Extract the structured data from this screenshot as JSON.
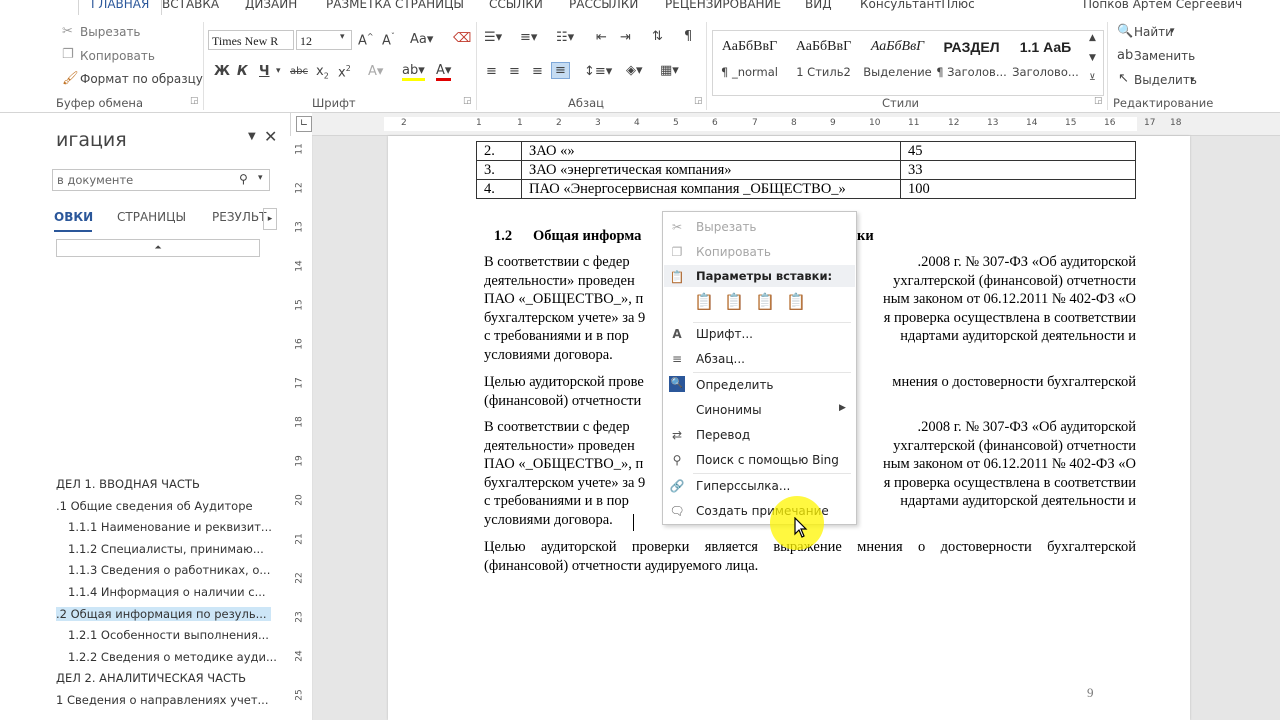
{
  "tabs": [
    "ГЛАВНАЯ",
    "ВСТАВКА",
    "ДИЗАЙН",
    "РАЗМЕТКА СТРАНИЦЫ",
    "ССЫЛКИ",
    "РАССЫЛКИ",
    "РЕЦЕНЗИРОВАНИЕ",
    "ВИД",
    "КонсультантПлюс"
  ],
  "user_name": "Попков Артем Сергеевич",
  "clipboard": {
    "cut": "Вырезать",
    "copy": "Копировать",
    "format_painter": "Формат по образцу",
    "label": "Буфер обмена"
  },
  "font": {
    "name": "Times New R",
    "size": "12",
    "label": "Шрифт"
  },
  "paragraph_label": "Абзац",
  "styles": {
    "label": "Стили",
    "items": [
      {
        "sample": "АаБбВвГ",
        "name": "¶ _normal"
      },
      {
        "sample": "АаБбВвГ",
        "name": "1 Стиль2"
      },
      {
        "sample": "АаБбВвГ",
        "name": "Выделение"
      },
      {
        "sample": "РАЗДЕЛ",
        "name": "¶ Заголов..."
      },
      {
        "sample": "1.1 АаБ",
        "name": "Заголово..."
      }
    ]
  },
  "editing": {
    "find": "Найти",
    "replace": "Заменить",
    "select": "Выделить",
    "label": "Редактирование"
  },
  "nav": {
    "title": "игация",
    "search_placeholder": "в документе",
    "tabs": [
      "ОВКИ",
      "СТРАНИЦЫ",
      "РЕЗУЛЬТ"
    ],
    "tree": [
      {
        "text": "ДЕЛ 1. ВВОДНАЯ ЧАСТЬ",
        "level": 0
      },
      {
        "text": ".1 Общие сведения об Аудиторе",
        "level": 1
      },
      {
        "text": "1.1.1 Наименование и реквизит...",
        "level": 2
      },
      {
        "text": "1.1.2 Специалисты, принимаю...",
        "level": 2
      },
      {
        "text": "1.1.3 Сведения о работниках, о...",
        "level": 2
      },
      {
        "text": "1.1.4 Информация о наличии с...",
        "level": 2
      },
      {
        "text": ".2 Общая информация по резуль...",
        "level": 1,
        "selected": true
      },
      {
        "text": "1.2.1 Особенности выполнения...",
        "level": 2
      },
      {
        "text": "1.2.2 Сведения о методике ауди...",
        "level": 2
      },
      {
        "text": "ДЕЛ 2. АНАЛИТИЧЕСКАЯ ЧАСТЬ",
        "level": 0
      },
      {
        "text": "1 Сведения о направлениях учет...",
        "level": 1
      }
    ]
  },
  "ruler": {
    "h_numbers": [
      "2",
      "1",
      "1",
      "2",
      "3",
      "4",
      "5",
      "6",
      "7",
      "8",
      "9",
      "10",
      "11",
      "12",
      "13",
      "14",
      "15",
      "16",
      "17",
      "18"
    ],
    "v_numbers": [
      "11",
      "12",
      "13",
      "14",
      "15",
      "16",
      "17",
      "18",
      "19",
      "20",
      "21",
      "22",
      "23",
      "24",
      "25"
    ]
  },
  "doc": {
    "table": [
      {
        "num": "2.",
        "name": "ЗАО «»",
        "value": "45"
      },
      {
        "num": "3.",
        "name": "ЗАО «энергетическая компания»",
        "value": "33"
      },
      {
        "num": "4.",
        "name": "ПАО «Энергосервисная компания _ОБЩЕСТВО_»",
        "value": "100"
      }
    ],
    "heading_num": "1.2",
    "heading_text": "Общая информа",
    "heading_tail": "ки",
    "p1_lines": [
      "В соответствии с федер ................................. .2008 г. № 307-ФЗ «Об аудиторской",
      "деятельности» проведен ................................. ухгалтерской (финансовой) отчетности",
      "ПАО «_ОБЩЕСТВО_», п ................................. ным законом от 06.12.2011 № 402-ФЗ «О",
      "бухгалтерском учете» за ................................. я проверка осуществлена в соответствии",
      "с требованиями и в пор ................................. ндартами аудиторской деятельности и",
      "условиями договора."
    ],
    "p1_left": [
      "В соответствии с федер",
      "деятельности» проведен",
      "ПАО «_ОБЩЕСТВО_», п",
      "бухгалтерском учете» за 9",
      "с требованиями и в пор",
      "условиями договора."
    ],
    "p1_right": [
      ".2008 г. № 307-ФЗ «Об аудиторской",
      "ухгалтерской (финансовой) отчетности",
      "ным законом от 06.12.2011 № 402-ФЗ «О",
      "я проверка осуществлена в соответствии",
      "ндартами аудиторской деятельности и",
      ""
    ],
    "p2_left": [
      "Целью аудиторской прове",
      "(финансовой) отчетности"
    ],
    "p2_right": [
      "мнения о достоверности бухгалтерской",
      ""
    ],
    "p3_left": [
      "В соответствии с федер",
      "деятельности» проведен",
      "ПАО «_ОБЩЕСТВО_», п",
      "бухгалтерском учете» за 9",
      "с требованиями и в пор",
      "условиями договора."
    ],
    "p3_right": [
      ".2008 г. № 307-ФЗ «Об аудиторской",
      "ухгалтерской (финансовой) отчетности",
      "ным законом от 06.12.2011 № 402-ФЗ «О",
      "я проверка осуществлена в соответствии",
      "ндартами аудиторской деятельности и",
      ""
    ],
    "p4": [
      "Целью аудиторской проверки является выражение мнения о достоверности бухгалтерской",
      "(финансовой) отчетности аудируемого лица."
    ],
    "page_number": "9"
  },
  "context_menu": {
    "cut": "Вырезать",
    "copy": "Копировать",
    "paste_options": "Параметры вставки:",
    "font": "Шрифт...",
    "paragraph": "Абзац...",
    "define": "Определить",
    "synonyms": "Синонимы",
    "translate": "Перевод",
    "bing": "Поиск с помощью Bing",
    "hyperlink": "Гиперссылка...",
    "comment": "Создать примечание"
  }
}
